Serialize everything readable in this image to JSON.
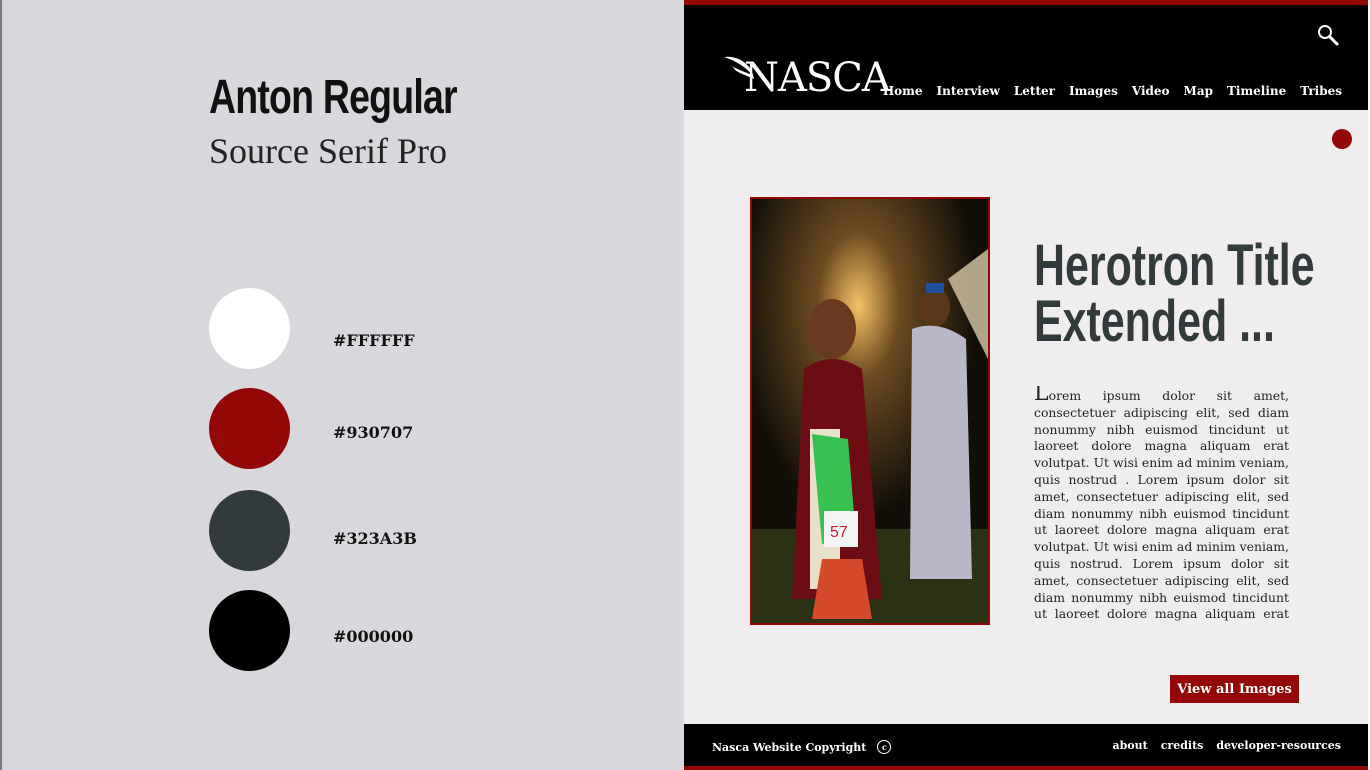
{
  "guide": {
    "font_primary": "Anton Regular",
    "font_secondary": "Source Serif Pro",
    "swatches": [
      {
        "hex": "#FFFFFF",
        "color": "#ffffff"
      },
      {
        "hex": "#930707",
        "color": "#930707"
      },
      {
        "hex": "#323A3B",
        "color": "#323a3b"
      },
      {
        "hex": "#000000",
        "color": "#000000"
      }
    ]
  },
  "site": {
    "logo": "NASCA",
    "logo_icon": "feather-icon",
    "search_icon": "search-icon",
    "nav": [
      "Home",
      "Interview",
      "Letter",
      "Images",
      "Video",
      "Map",
      "Timeline",
      "Tribes"
    ],
    "hero": {
      "title_line1": "Herotron Title",
      "title_line2": "Extended ...",
      "body": "Lorem ipsum dolor sit amet, consectetuer adipiscing elit, sed diam nonummy nibh euismod tincidunt ut laoreet dolore magna aliquam erat volutpat. Ut wisi enim ad minim veniam, quis nostrud . Lorem ipsum dolor sit amet, consectetuer adipiscing elit, sed diam nonummy nibh euismod tincidunt ut laoreet dolore magna aliquam erat volutpat. Ut wisi enim ad minim veniam, quis nostrud. Lorem ipsum dolor sit amet, consectetuer adipiscing elit, sed diam nonummy nibh euismod tincidunt ut laoreet dolore magna aliquam erat volut-",
      "button": "View all Images"
    },
    "footer": {
      "copyright": "Nasca Website Copyright",
      "copyright_symbol": "c",
      "links": [
        "about",
        "credits",
        "developer-resources"
      ]
    },
    "colors": {
      "accent": "#930707",
      "dark": "#323a3b",
      "bar": "#000000"
    }
  }
}
